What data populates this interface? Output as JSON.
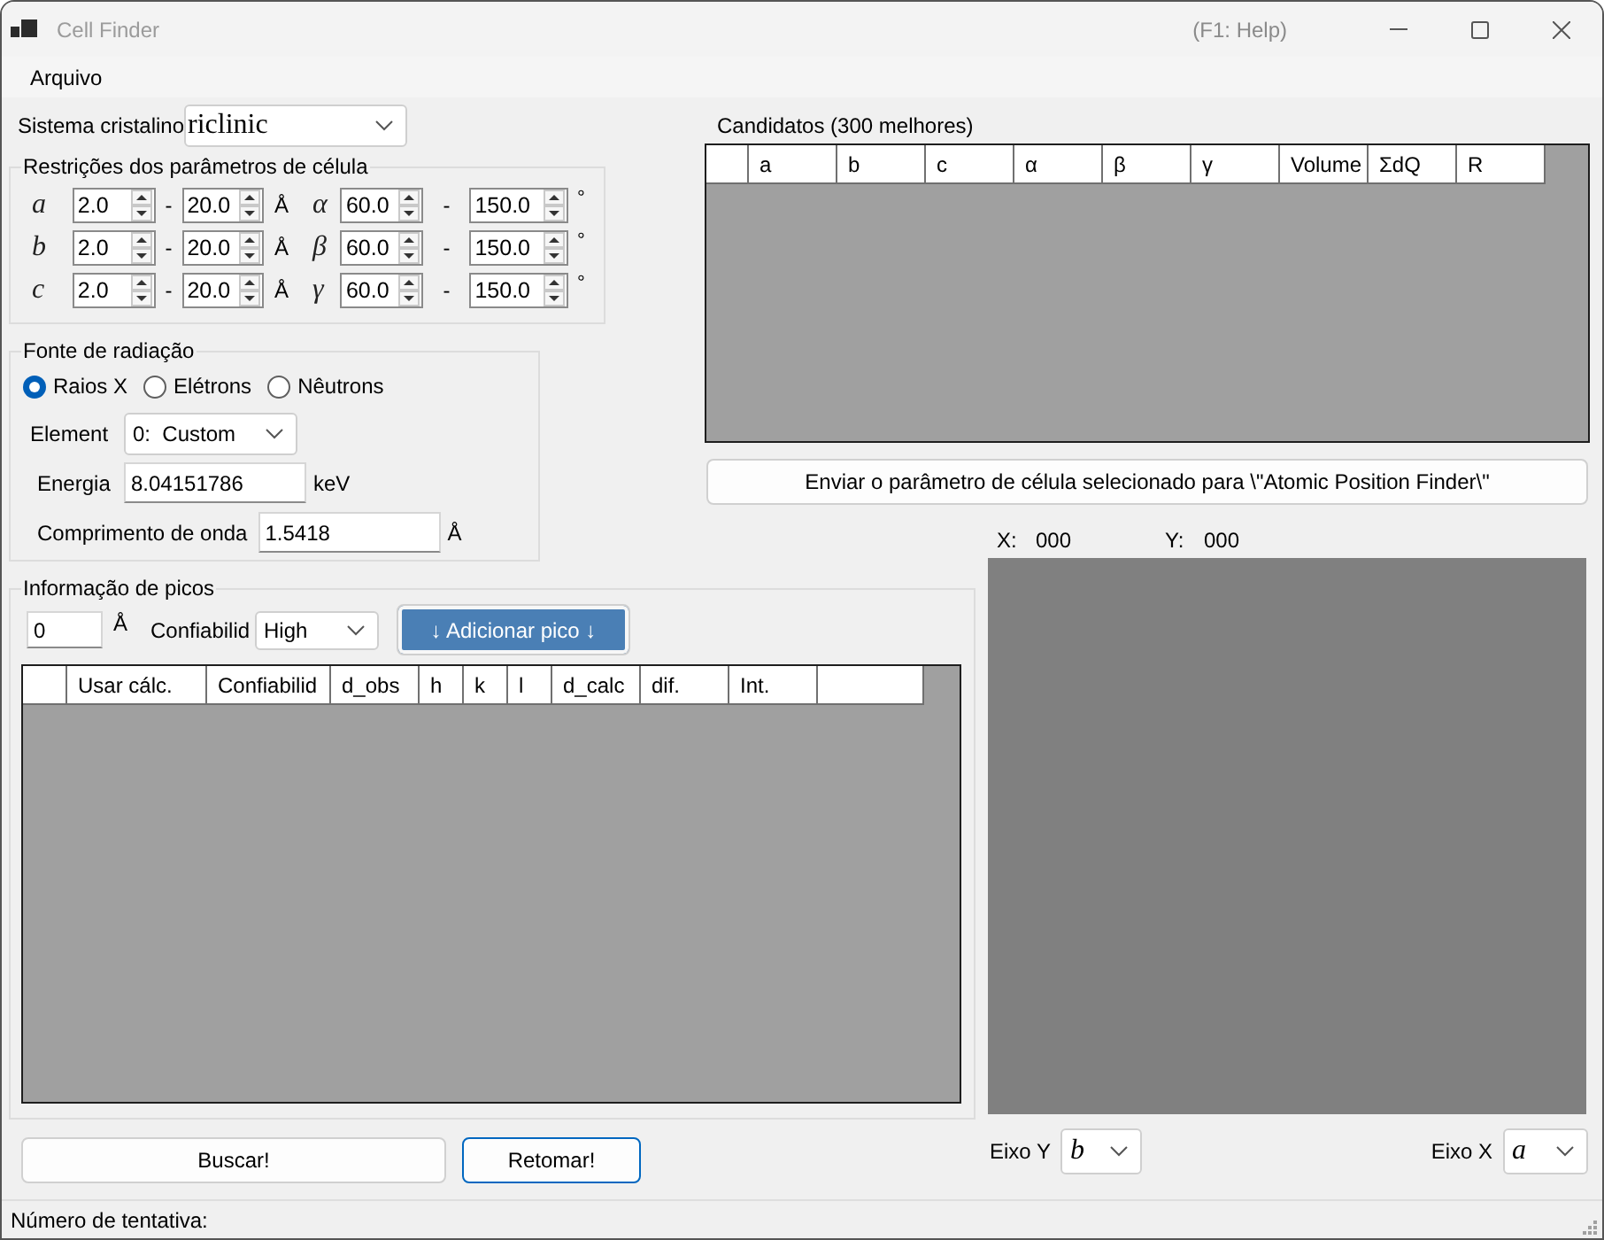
{
  "window": {
    "title": "Cell Finder",
    "help_hint": "(F1: Help)"
  },
  "menu": [
    {
      "label": "Arquivo"
    }
  ],
  "crystal_system": {
    "label": "Sistema cristalino",
    "value": "riclinic"
  },
  "restrictions": {
    "title": "Restrições dos parâmetros de célula",
    "rows": [
      {
        "length": {
          "symbol": "a",
          "min": "2.0",
          "dash": "-",
          "max": "20.0",
          "unit": "Å"
        },
        "angle": {
          "symbol": "α",
          "min": "60.0",
          "dash": "-",
          "max": "150.0",
          "unit": "°"
        }
      },
      {
        "length": {
          "symbol": "b",
          "min": "2.0",
          "dash": "-",
          "max": "20.0",
          "unit": "Å"
        },
        "angle": {
          "symbol": "β",
          "min": "60.0",
          "dash": "-",
          "max": "150.0",
          "unit": "°"
        }
      },
      {
        "length": {
          "symbol": "c",
          "min": "2.0",
          "dash": "-",
          "max": "20.0",
          "unit": "Å"
        },
        "angle": {
          "symbol": "γ",
          "min": "60.0",
          "dash": "-",
          "max": "150.0",
          "unit": "°"
        }
      }
    ]
  },
  "radiation": {
    "title": "Fonte de radiação",
    "options": [
      {
        "label": "Raios X",
        "selected": true
      },
      {
        "label": "Elétrons",
        "selected": false
      },
      {
        "label": "Nêutrons",
        "selected": false
      }
    ],
    "element": {
      "label": "Element",
      "value": "0:  Custom"
    },
    "energy": {
      "label": "Energia",
      "value": "8.04151786",
      "unit": "keV"
    },
    "wavelength": {
      "label": "Comprimento de onda",
      "value": "1.5418",
      "unit": "Å"
    }
  },
  "candidates": {
    "title": "Candidatos (300 melhores)",
    "table": {
      "columns": [
        {
          "label": "a"
        },
        {
          "label": "b"
        },
        {
          "label": "c"
        },
        {
          "label": "α"
        },
        {
          "label": "β"
        },
        {
          "label": "γ"
        },
        {
          "label": "Volume"
        },
        {
          "label": "ΣdQ"
        },
        {
          "label": "R"
        }
      ]
    },
    "send_button": "Enviar o parâmetro de célula selecionado para \\\"Atomic Position Finder\\\""
  },
  "peaks": {
    "title": "Informação de picos",
    "d_input": {
      "value": "0",
      "unit": "Å"
    },
    "confidence": {
      "label": "Confiabilid",
      "value": "High"
    },
    "add_button": "↓ Adicionar pico ↓",
    "table": {
      "columns": [
        {
          "kind": "text",
          "label": "Usar cálc."
        },
        {
          "kind": "text",
          "label": "Confiabilid"
        },
        {
          "kind": "text",
          "label": "d_obs"
        },
        {
          "kind": "text",
          "label": "h"
        },
        {
          "kind": "text",
          "label": "k"
        },
        {
          "kind": "text",
          "label": "l"
        },
        {
          "kind": "text",
          "label": "d_calc"
        },
        {
          "kind": "text",
          "label": "dif."
        },
        {
          "kind": "text",
          "label": "Int."
        },
        {
          "kind": "blank"
        }
      ]
    }
  },
  "buttons": [
    {
      "label": "Buscar!",
      "focused": false
    },
    {
      "label": "Retomar!",
      "focused": true
    }
  ],
  "plot": {
    "x_label": "X:",
    "x_value": "000",
    "y_label": "Y:",
    "y_value": "000",
    "y_axis": {
      "label": "Eixo Y",
      "value": "b"
    },
    "x_axis": {
      "label": "Eixo X",
      "value": "a"
    }
  },
  "status_bar": {
    "text": "Número de tentativa:"
  }
}
